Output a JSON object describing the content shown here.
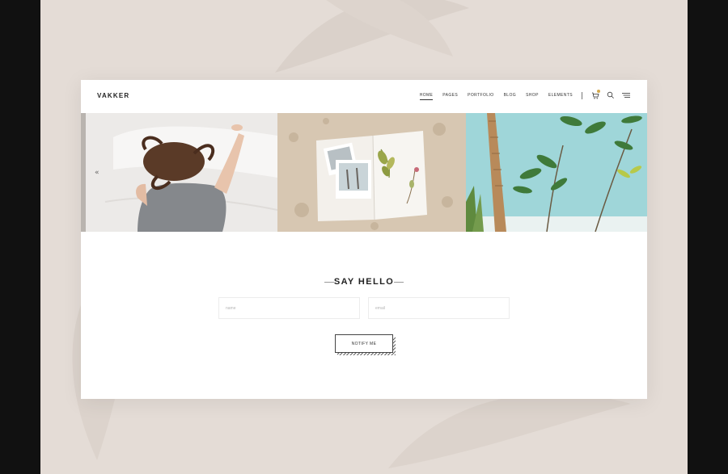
{
  "header": {
    "logo": "VAKKER",
    "nav": [
      {
        "label": "HOME",
        "active": true
      },
      {
        "label": "PAGES",
        "active": false
      },
      {
        "label": "PORTFOLIO",
        "active": false
      },
      {
        "label": "BLOG",
        "active": false
      },
      {
        "label": "SHOP",
        "active": false
      },
      {
        "label": "ELEMENTS",
        "active": false
      }
    ],
    "icons": [
      "cart-icon",
      "search-icon",
      "menu-icon"
    ],
    "accent_color": "#d3a94c"
  },
  "hero": {
    "prev_arrow": "«"
  },
  "contact": {
    "title": "SAY HELLO",
    "name_placeholder": "name",
    "email_placeholder": "email",
    "button_label": "NOTIFY ME"
  }
}
